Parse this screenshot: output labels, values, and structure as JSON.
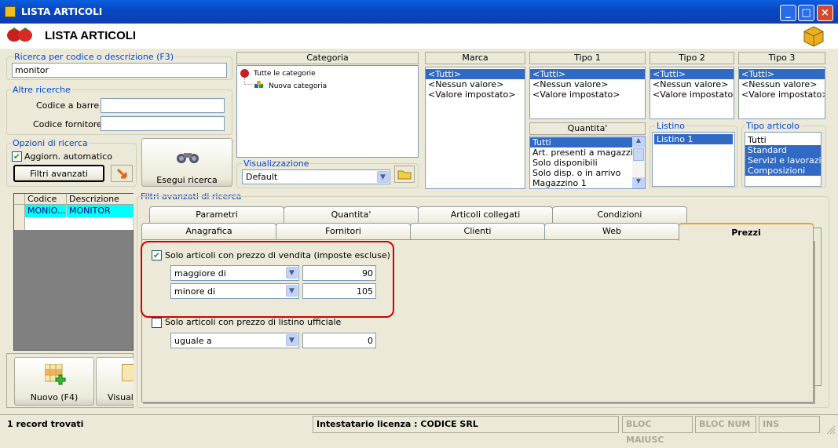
{
  "window": {
    "title": "LISTA ARTICOLI"
  },
  "header": {
    "title": "LISTA ARTICOLI"
  },
  "search": {
    "label": "Ricerca per codice o descrizione (F3)",
    "value": "monitor"
  },
  "other": {
    "label": "Altre ricerche",
    "barcode_label": "Codice a barre :",
    "supplier_label": "Codice fornitore :"
  },
  "options": {
    "label": "Opzioni di ricerca",
    "auto_label": "Aggiorn. automatico",
    "auto_checked": true,
    "advanced_button": "Filtri avanzati"
  },
  "search_button": "Esegui ricerca",
  "category": {
    "header": "Categoria",
    "items": [
      "Tutte le categorie",
      "Nuova categoria"
    ]
  },
  "view": {
    "label": "Visualizzazione",
    "value": "Default"
  },
  "marca": {
    "header": "Marca",
    "items": [
      "<Tutti>",
      "<Nessun valore>",
      "<Valore impostato>"
    ]
  },
  "tipo1": {
    "header": "Tipo 1",
    "items": [
      "<Tutti>",
      "<Nessun valore>",
      "<Valore impostato>"
    ]
  },
  "tipo2": {
    "header": "Tipo 2",
    "items": [
      "<Tutti>",
      "<Nessun valore>",
      "<Valore impostato>"
    ]
  },
  "tipo3": {
    "header": "Tipo 3",
    "items": [
      "<Tutti>",
      "<Nessun valore>",
      "<Valore impostato>"
    ]
  },
  "quantita": {
    "header": "Quantita'",
    "items": [
      "Tutti",
      "Art. presenti a magazzino",
      "Solo disponibili",
      "Solo disp. o in arrivo",
      "Magazzino 1"
    ]
  },
  "listino": {
    "label": "Listino",
    "items": [
      "Listino 1"
    ]
  },
  "tipo_articolo": {
    "label": "Tipo articolo",
    "items": [
      "Tutti",
      "Standard",
      "Servizi e lavorazioni",
      "Composizioni"
    ]
  },
  "grid": {
    "headers": [
      "Codice",
      "Descrizione"
    ],
    "rows": [
      [
        "MONIO...",
        "MONITOR"
      ]
    ]
  },
  "actions": {
    "new": "Nuovo (F4)",
    "view": "Visuali"
  },
  "filters": {
    "label": "Filtri avanzati di ricerca",
    "tabs_row1": [
      "Parametri",
      "Quantita'",
      "Articoli collegati",
      "Condizioni"
    ],
    "tabs_row2": [
      "Anagrafica",
      "Fornitori",
      "Clienti",
      "Web",
      "Prezzi"
    ],
    "sale_check_label": "Solo articoli con prezzo di vendita (imposte escluse)",
    "sale_checked": true,
    "op1": "maggiore di",
    "val1": "90",
    "op2": "minore di",
    "val2": "105",
    "list_check_label": "Solo articoli con prezzo di listino ufficiale",
    "list_checked": false,
    "op3": "uguale a",
    "val3": "0"
  },
  "status": {
    "records": "1 record trovati",
    "license": "Intestatario licenza : CODICE SRL",
    "caps": "BLOC MAIUSC",
    "num": "BLOC NUM",
    "ins": "INS"
  },
  "colors": {
    "titlebar": "#0a5fe0",
    "selection": "#316ac5",
    "grid_selected": "#00ffff",
    "highlight": "#d40000"
  }
}
